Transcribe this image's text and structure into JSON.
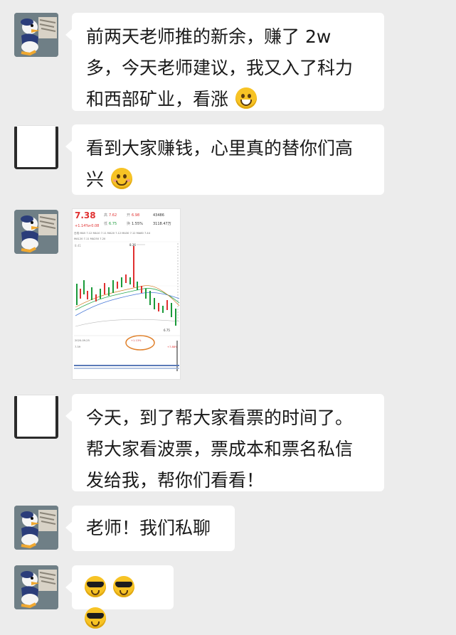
{
  "messages": [
    {
      "sender": "duck",
      "text": "前两天老师推的新余，赚了 2w 多，今天老师建议，我又入了科力和西部矿业，看涨",
      "emoji": "grin"
    },
    {
      "sender": "blank",
      "text": "看到大家赚钱，心里真的替你们高兴",
      "emoji": "smile"
    },
    {
      "sender": "duck",
      "type": "image"
    },
    {
      "sender": "blank",
      "text": "今天，到了帮大家看票的时间了。帮大家看波票，票成本和票名私信发给我，帮你们看看！"
    },
    {
      "sender": "duck",
      "text": "老师！我们私聊"
    },
    {
      "sender": "duck",
      "emojis": [
        "cool",
        "cool",
        "cool"
      ]
    }
  ],
  "stock_image": {
    "price": "7.38",
    "change": "+1.14%",
    "change_amount": "+0.08",
    "high_label": "高",
    "high": "7.62",
    "open_label": "开",
    "open": "6.98",
    "volume": "43486",
    "low_label": "低",
    "low": "6.75",
    "turnover_label": "换",
    "turnover": "1.55%",
    "amount": "3118.47万",
    "ma_line1": "日线  MA5 7.12  MA10 7.11  MA20 7.12  MA30 7.12  MA60 7.44",
    "ma_line2": "MA120 7.11  MA250 7.20",
    "peak_label": "8.36",
    "low_mark": "6.75",
    "top_left_tick": "8.41",
    "mid_ticks": [
      "8.13",
      "7.63",
      "7.38",
      "6.60"
    ],
    "date": "2020-09-25",
    "indicator": "+1.13%",
    "bottom_right": "+7.88%",
    "bottom_left": "7.39",
    "colors": {
      "up": "#e03030",
      "down": "#1a9a3a",
      "circle": "#e0802a",
      "ma_green": "#2aa852",
      "ma_blue": "#4a7ad8"
    }
  }
}
